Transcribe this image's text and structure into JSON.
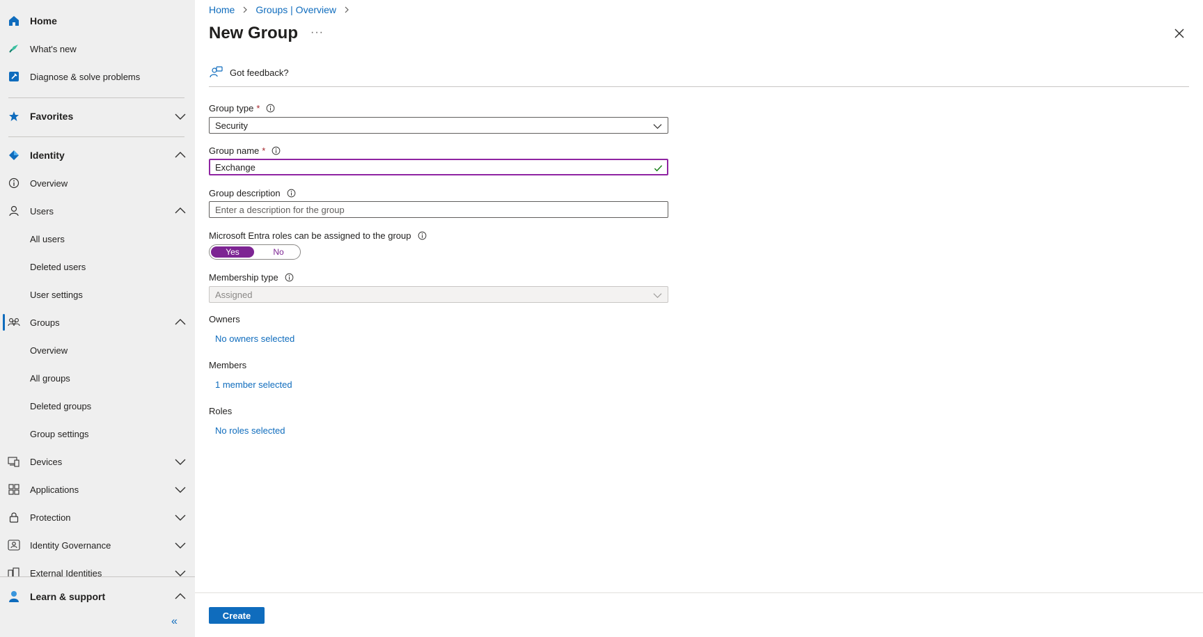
{
  "sidebar": {
    "items": {
      "home": "Home",
      "whats_new": "What's new",
      "diagnose": "Diagnose & solve problems",
      "favorites": "Favorites",
      "identity": "Identity",
      "overview": "Overview",
      "users": "Users",
      "all_users": "All users",
      "deleted_users": "Deleted users",
      "user_settings": "User settings",
      "groups": "Groups",
      "groups_overview": "Overview",
      "all_groups": "All groups",
      "deleted_groups": "Deleted groups",
      "group_settings": "Group settings",
      "devices": "Devices",
      "applications": "Applications",
      "protection": "Protection",
      "identity_governance": "Identity Governance",
      "external_identities": "External Identities",
      "learn_support": "Learn & support"
    },
    "collapse_glyph": "«",
    "accent_color": "#0f6cbd"
  },
  "breadcrumb": [
    "Home",
    "Groups | Overview"
  ],
  "page": {
    "title": "New Group",
    "more_glyph": "···",
    "feedback_label": "Got feedback?"
  },
  "form": {
    "group_type": {
      "label": "Group type",
      "required_mark": "*",
      "value": "Security"
    },
    "group_name": {
      "label": "Group name",
      "required_mark": "*",
      "value": "Exchange"
    },
    "group_description": {
      "label": "Group description",
      "placeholder": "Enter a description for the group"
    },
    "entra_roles": {
      "label": "Microsoft Entra roles can be assigned to the group",
      "yes": "Yes",
      "no": "No",
      "selected": "Yes"
    },
    "membership_type": {
      "label": "Membership type",
      "value": "Assigned"
    },
    "owners": {
      "label": "Owners",
      "link": "No owners selected"
    },
    "members": {
      "label": "Members",
      "link": "1 member selected"
    },
    "roles": {
      "label": "Roles",
      "link": "No roles selected"
    }
  },
  "footer": {
    "create_label": "Create"
  },
  "colors": {
    "toggle_accent": "#7d2593",
    "focus_border": "#8f24a2",
    "link": "#0f6cbd",
    "required": "#a4262c"
  }
}
